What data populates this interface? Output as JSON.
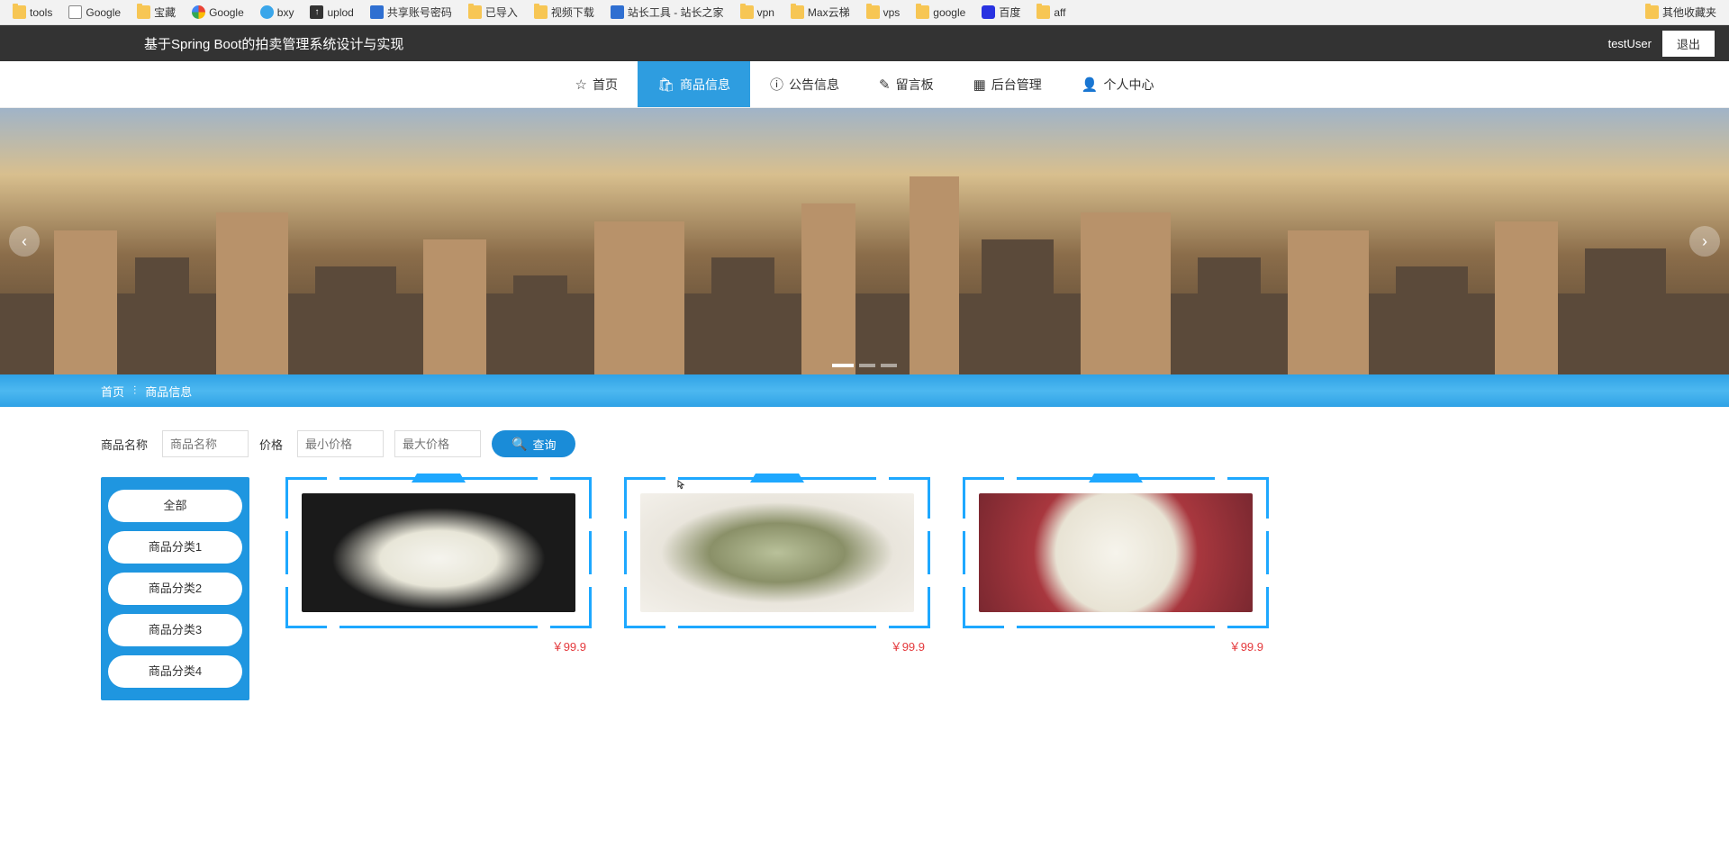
{
  "bookmarks": {
    "left": [
      {
        "label": "tools",
        "icon": "folder"
      },
      {
        "label": "Google",
        "icon": "file"
      },
      {
        "label": "宝藏",
        "icon": "folder"
      },
      {
        "label": "Google",
        "icon": "google"
      },
      {
        "label": "bxy",
        "icon": "cloud"
      },
      {
        "label": "uplod",
        "icon": "upload"
      },
      {
        "label": "共享账号密码",
        "icon": "square"
      },
      {
        "label": "已导入",
        "icon": "folder"
      },
      {
        "label": "视频下载",
        "icon": "folder"
      },
      {
        "label": "站长工具 - 站长之家",
        "icon": "tool"
      },
      {
        "label": "vpn",
        "icon": "folder"
      },
      {
        "label": "Max云梯",
        "icon": "folder"
      },
      {
        "label": "vps",
        "icon": "folder"
      },
      {
        "label": "google",
        "icon": "folder"
      },
      {
        "label": "百度",
        "icon": "baidu"
      },
      {
        "label": "aff",
        "icon": "folder"
      }
    ],
    "right": {
      "label": "其他收藏夹",
      "icon": "folder"
    }
  },
  "header": {
    "title": "基于Spring Boot的拍卖管理系统设计与实现",
    "username": "testUser",
    "logout": "退出"
  },
  "nav": [
    {
      "icon": "☆",
      "label": "首页",
      "active": false
    },
    {
      "icon": "🛍",
      "label": "商品信息",
      "active": true
    },
    {
      "icon": "ⓘ",
      "label": "公告信息",
      "active": false
    },
    {
      "icon": "✎",
      "label": "留言板",
      "active": false
    },
    {
      "icon": "▦",
      "label": "后台管理",
      "active": false
    },
    {
      "icon": "👤",
      "label": "个人中心",
      "active": false
    }
  ],
  "breadcrumb": {
    "home": "首页",
    "sep": "⫶",
    "current": "商品信息"
  },
  "search": {
    "nameLabel": "商品名称",
    "namePlaceholder": "商品名称",
    "priceLabel": "价格",
    "minPlaceholder": "最小价格",
    "maxPlaceholder": "最大价格",
    "btn": "查询"
  },
  "categories": [
    "全部",
    "商品分类1",
    "商品分类2",
    "商品分类3",
    "商品分类4"
  ],
  "products": [
    {
      "imgClass": "jade1",
      "price": "￥99.9"
    },
    {
      "imgClass": "jade2",
      "price": "￥99.9"
    },
    {
      "imgClass": "jade3",
      "price": "￥99.9"
    }
  ]
}
